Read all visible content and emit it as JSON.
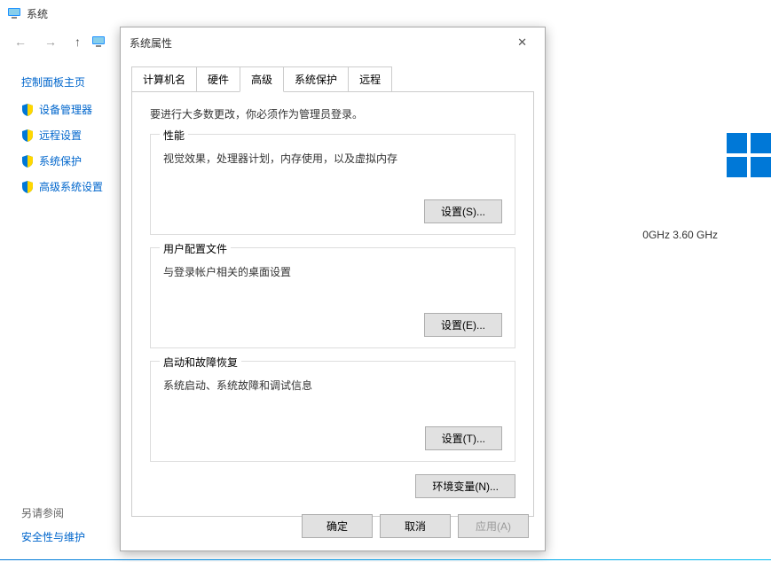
{
  "titlebar": {
    "label": "系统"
  },
  "sidebar": {
    "header": "控制面板主页",
    "items": [
      {
        "label": "设备管理器"
      },
      {
        "label": "远程设置"
      },
      {
        "label": "系统保护"
      },
      {
        "label": "高级系统设置"
      }
    ]
  },
  "see_also": {
    "header": "另请参阅",
    "link": "安全性与维护"
  },
  "bg": {
    "cpu_info": "0GHz  3.60 GHz"
  },
  "dialog": {
    "title": "系统属性",
    "tabs": [
      {
        "label": "计算机名"
      },
      {
        "label": "硬件"
      },
      {
        "label": "高级"
      },
      {
        "label": "系统保护"
      },
      {
        "label": "远程"
      }
    ],
    "intro": "要进行大多数更改，你必须作为管理员登录。",
    "sections": [
      {
        "legend": "性能",
        "desc": "视觉效果，处理器计划，内存使用，以及虚拟内存",
        "button": "设置(S)..."
      },
      {
        "legend": "用户配置文件",
        "desc": "与登录帐户相关的桌面设置",
        "button": "设置(E)..."
      },
      {
        "legend": "启动和故障恢复",
        "desc": "系统启动、系统故障和调试信息",
        "button": "设置(T)..."
      }
    ],
    "env_button": "环境变量(N)...",
    "buttons": {
      "ok": "确定",
      "cancel": "取消",
      "apply": "应用(A)"
    }
  }
}
